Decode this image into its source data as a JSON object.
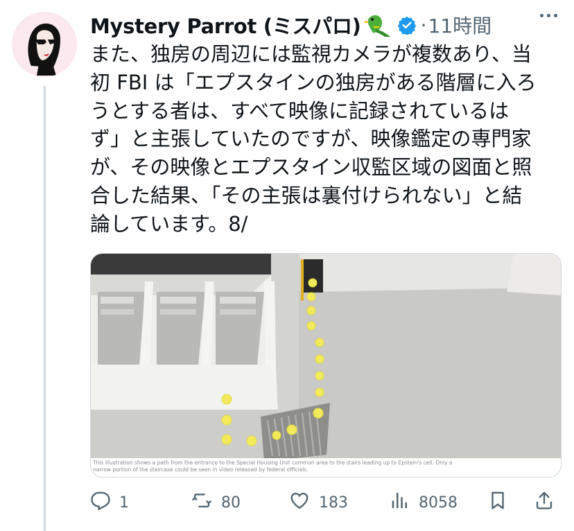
{
  "author": {
    "name": "Mystery Parrot (ミスパロ)",
    "name_emoji_icon": "parrot-icon",
    "verified_icon": "verified-badge-icon",
    "timestamp": "11時間",
    "separator": "·"
  },
  "tweet": {
    "lines": [
      "また、独房の周辺には監視カメラが複数あり、当",
      "初 FBI は「エプスタインの独房がある階層に入ろ",
      "うとする者は、すべて映像に記録されているは",
      "ず」と主張していたのですが、映像鑑定の専門家",
      "が、その映像とエプスタイン収監区域の図面と照",
      "合した結果、「その主張は裏付けられない」と結",
      "論しています。8/"
    ]
  },
  "media": {
    "caption_lines": [
      "This illustration shows a path from the entrance to the Special Housing Unit common area to the stairs leading up to Epstein's cell. Only a",
      "narrow portion of the staircase could be seen in video released by federal officials."
    ]
  },
  "actions": {
    "replies": "1",
    "reposts": "80",
    "likes": "183",
    "views": "8058"
  },
  "colors": {
    "text": "#0f1419",
    "secondary": "#536471",
    "verified": "#1d9bf0",
    "border": "#cfd9de",
    "path_dot": "#f2ea5c"
  }
}
